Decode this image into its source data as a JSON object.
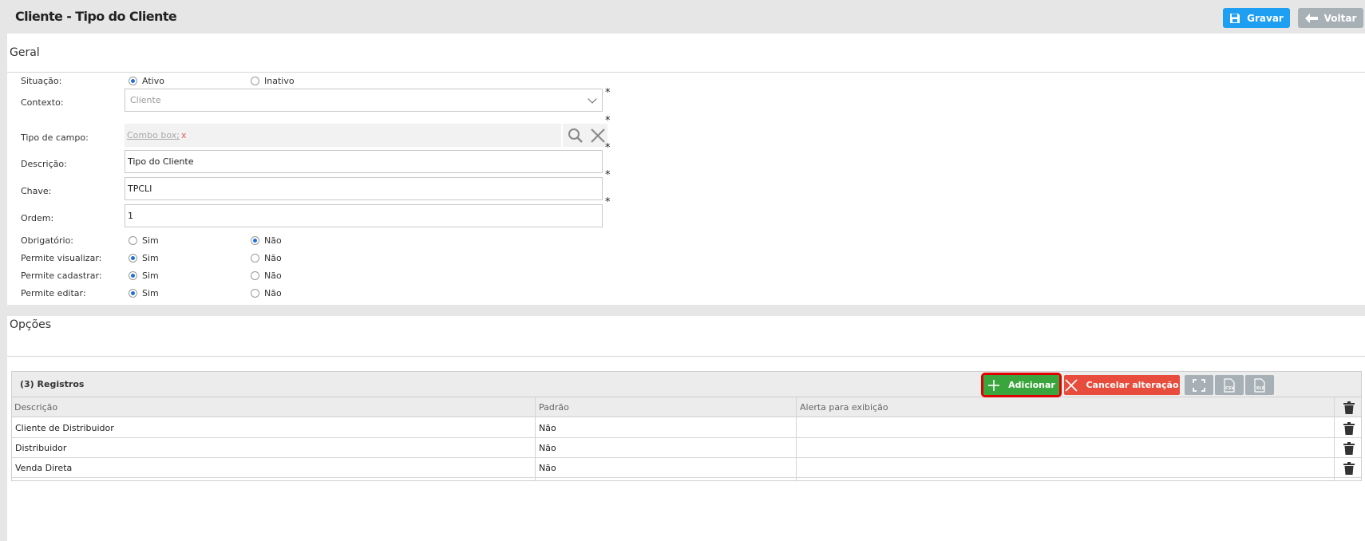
{
  "header": {
    "title": "Cliente - Tipo do Cliente",
    "save_label": "Gravar",
    "back_label": "Voltar"
  },
  "geral": {
    "section_title": "Geral",
    "situacao": {
      "label": "Situação:",
      "options": [
        "Ativo",
        "Inativo"
      ],
      "selected": "Ativo"
    },
    "contexto": {
      "label": "Contexto:",
      "value": "Cliente"
    },
    "tipo_campo": {
      "label": "Tipo de campo:",
      "placeholder": "Combo box;",
      "clear": "x"
    },
    "descricao": {
      "label": "Descrição:",
      "value": "Tipo do Cliente"
    },
    "chave": {
      "label": "Chave:",
      "value": "TPCLI"
    },
    "ordem": {
      "label": "Ordem:",
      "value": "1"
    },
    "required_mark": "*",
    "obrigatorio": {
      "label": "Obrigatório:",
      "options": [
        "Sim",
        "Não"
      ],
      "selected": "Não"
    },
    "permite_visualizar": {
      "label": "Permite visualizar:",
      "options": [
        "Sim",
        "Não"
      ],
      "selected": "Sim"
    },
    "permite_cadastrar": {
      "label": "Permite cadastrar:",
      "options": [
        "Sim",
        "Não"
      ],
      "selected": "Sim"
    },
    "permite_editar": {
      "label": "Permite editar:",
      "options": [
        "Sim",
        "Não"
      ],
      "selected": "Sim"
    }
  },
  "opcoes": {
    "section_title": "Opções",
    "registros_label": "(3) Registros",
    "add_label": "Adicionar",
    "cancel_label": "Cancelar alteração",
    "columns": [
      "Descrição",
      "Padrão",
      "Alerta para exibição"
    ],
    "rows": [
      {
        "descricao": "Cliente de Distribuidor",
        "padrao": "Não",
        "alerta": ""
      },
      {
        "descricao": "Distribuidor",
        "padrao": "Não",
        "alerta": ""
      },
      {
        "descricao": "Venda Direta",
        "padrao": "Não",
        "alerta": ""
      }
    ],
    "icons": {
      "fullscreen": "fullscreen-icon",
      "csv": "csv-icon",
      "xls": "xls-icon",
      "trash": "trash-icon"
    }
  },
  "colors": {
    "primary": "#1e9ff2",
    "success": "#3ba53d",
    "danger": "#e74c3c",
    "muted": "#a6b0b5",
    "highlight": "#e00000"
  }
}
